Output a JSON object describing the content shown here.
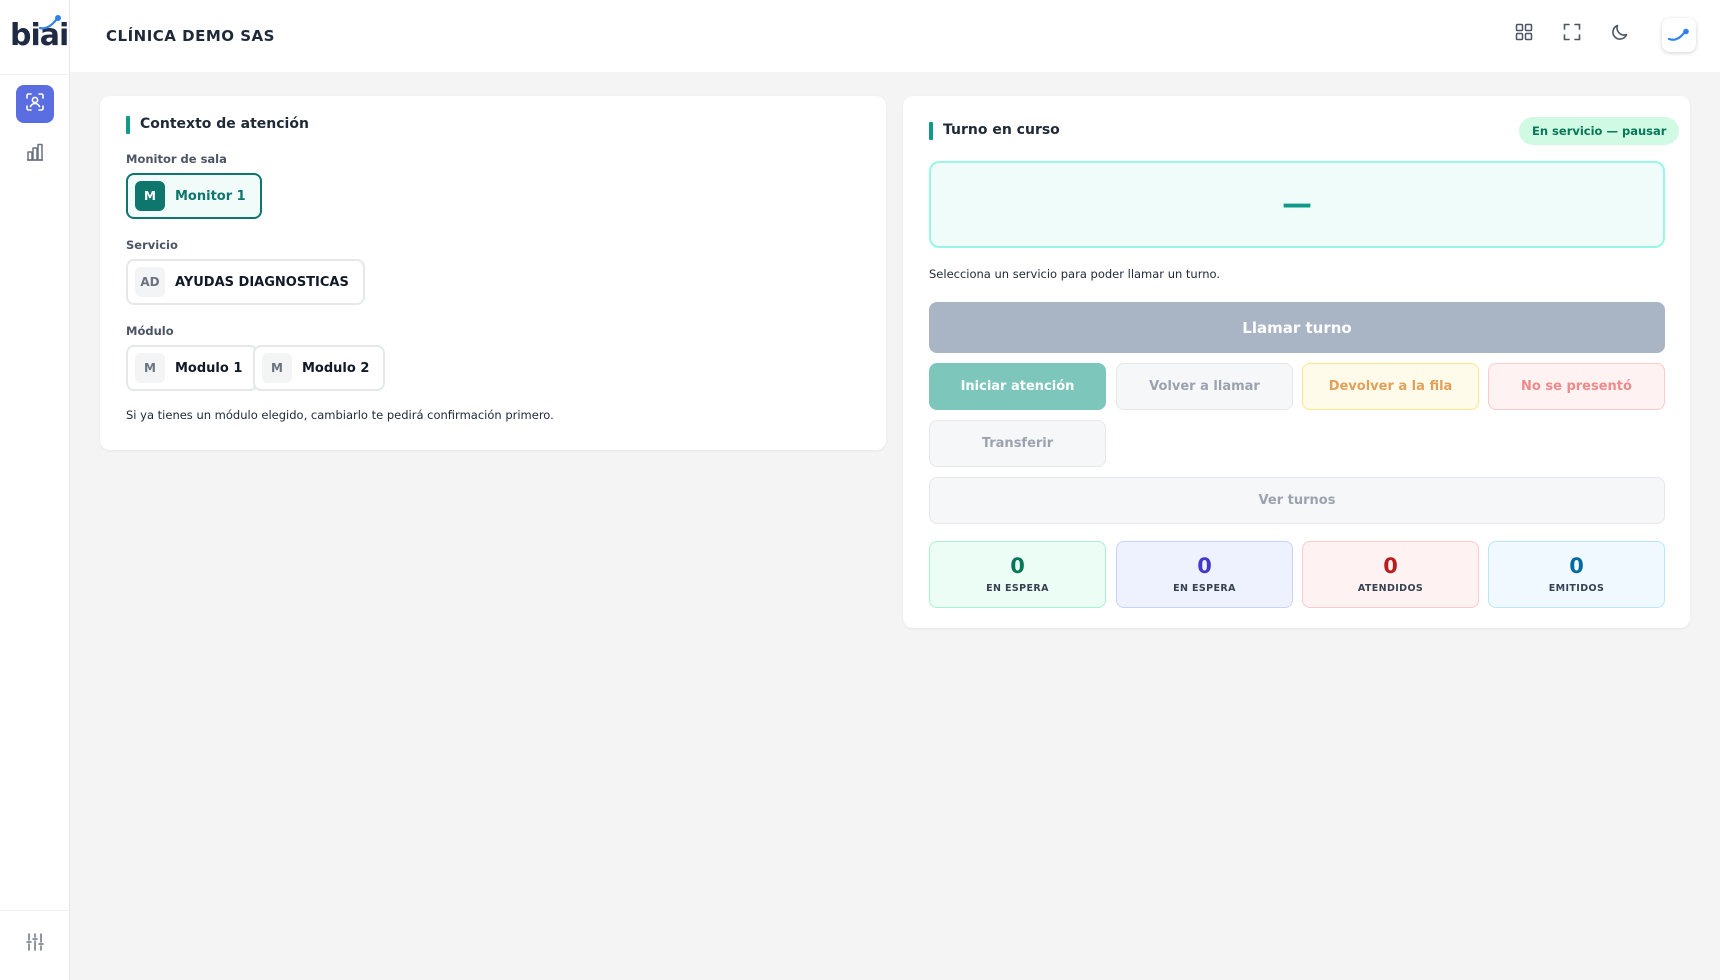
{
  "app": {
    "logo_text": "biai",
    "company_name": "CLÍNICA DEMO SAS"
  },
  "sidebar": {
    "items": [
      {
        "icon": "user-scan-icon",
        "active": true
      },
      {
        "icon": "bar-chart-icon",
        "active": false
      }
    ],
    "bottom_icon": "sliders-icon"
  },
  "header": {
    "icons": [
      "grid-icon",
      "fullscreen-icon",
      "moon-icon",
      "avatar"
    ]
  },
  "context": {
    "title": "Contexto de atención",
    "monitor": {
      "label": "Monitor de sala",
      "options": [
        {
          "badge": "M",
          "label": "Monitor 1",
          "selected": true
        }
      ]
    },
    "service": {
      "label": "Servicio",
      "options": [
        {
          "badge": "AD",
          "label": "AYUDAS DIAGNOSTICAS",
          "selected": false
        }
      ]
    },
    "module": {
      "label": "Módulo",
      "options": [
        {
          "badge": "M",
          "label": "Modulo 1",
          "selected": false
        },
        {
          "badge": "M",
          "label": "Modulo 2",
          "selected": false
        }
      ]
    },
    "hint": "Si ya tienes un módulo elegido, cambiarlo te pedirá confirmación primero."
  },
  "turn": {
    "title": "Turno en curso",
    "status": "En servicio — pausar",
    "current": "—",
    "helper": "Selecciona un servicio para poder llamar un turno.",
    "buttons": {
      "call": "Llamar turno",
      "start": "Iniciar atención",
      "recall": "Volver a llamar",
      "return": "Devolver a la fila",
      "no_show": "No se presentó",
      "transfer": "Transferir",
      "view": "Ver turnos"
    },
    "stats": [
      {
        "value": "0",
        "label": "EN ESPERA"
      },
      {
        "value": "0",
        "label": "EN ESPERA"
      },
      {
        "value": "0",
        "label": "ATENDIDOS"
      },
      {
        "value": "0",
        "label": "EMITIDOS"
      }
    ]
  },
  "colors": {
    "accent": "#0f9a8a",
    "sidebar_active": "#5b6ee1",
    "selected_chip": "#0f766e",
    "background": "#f4f4f4"
  }
}
